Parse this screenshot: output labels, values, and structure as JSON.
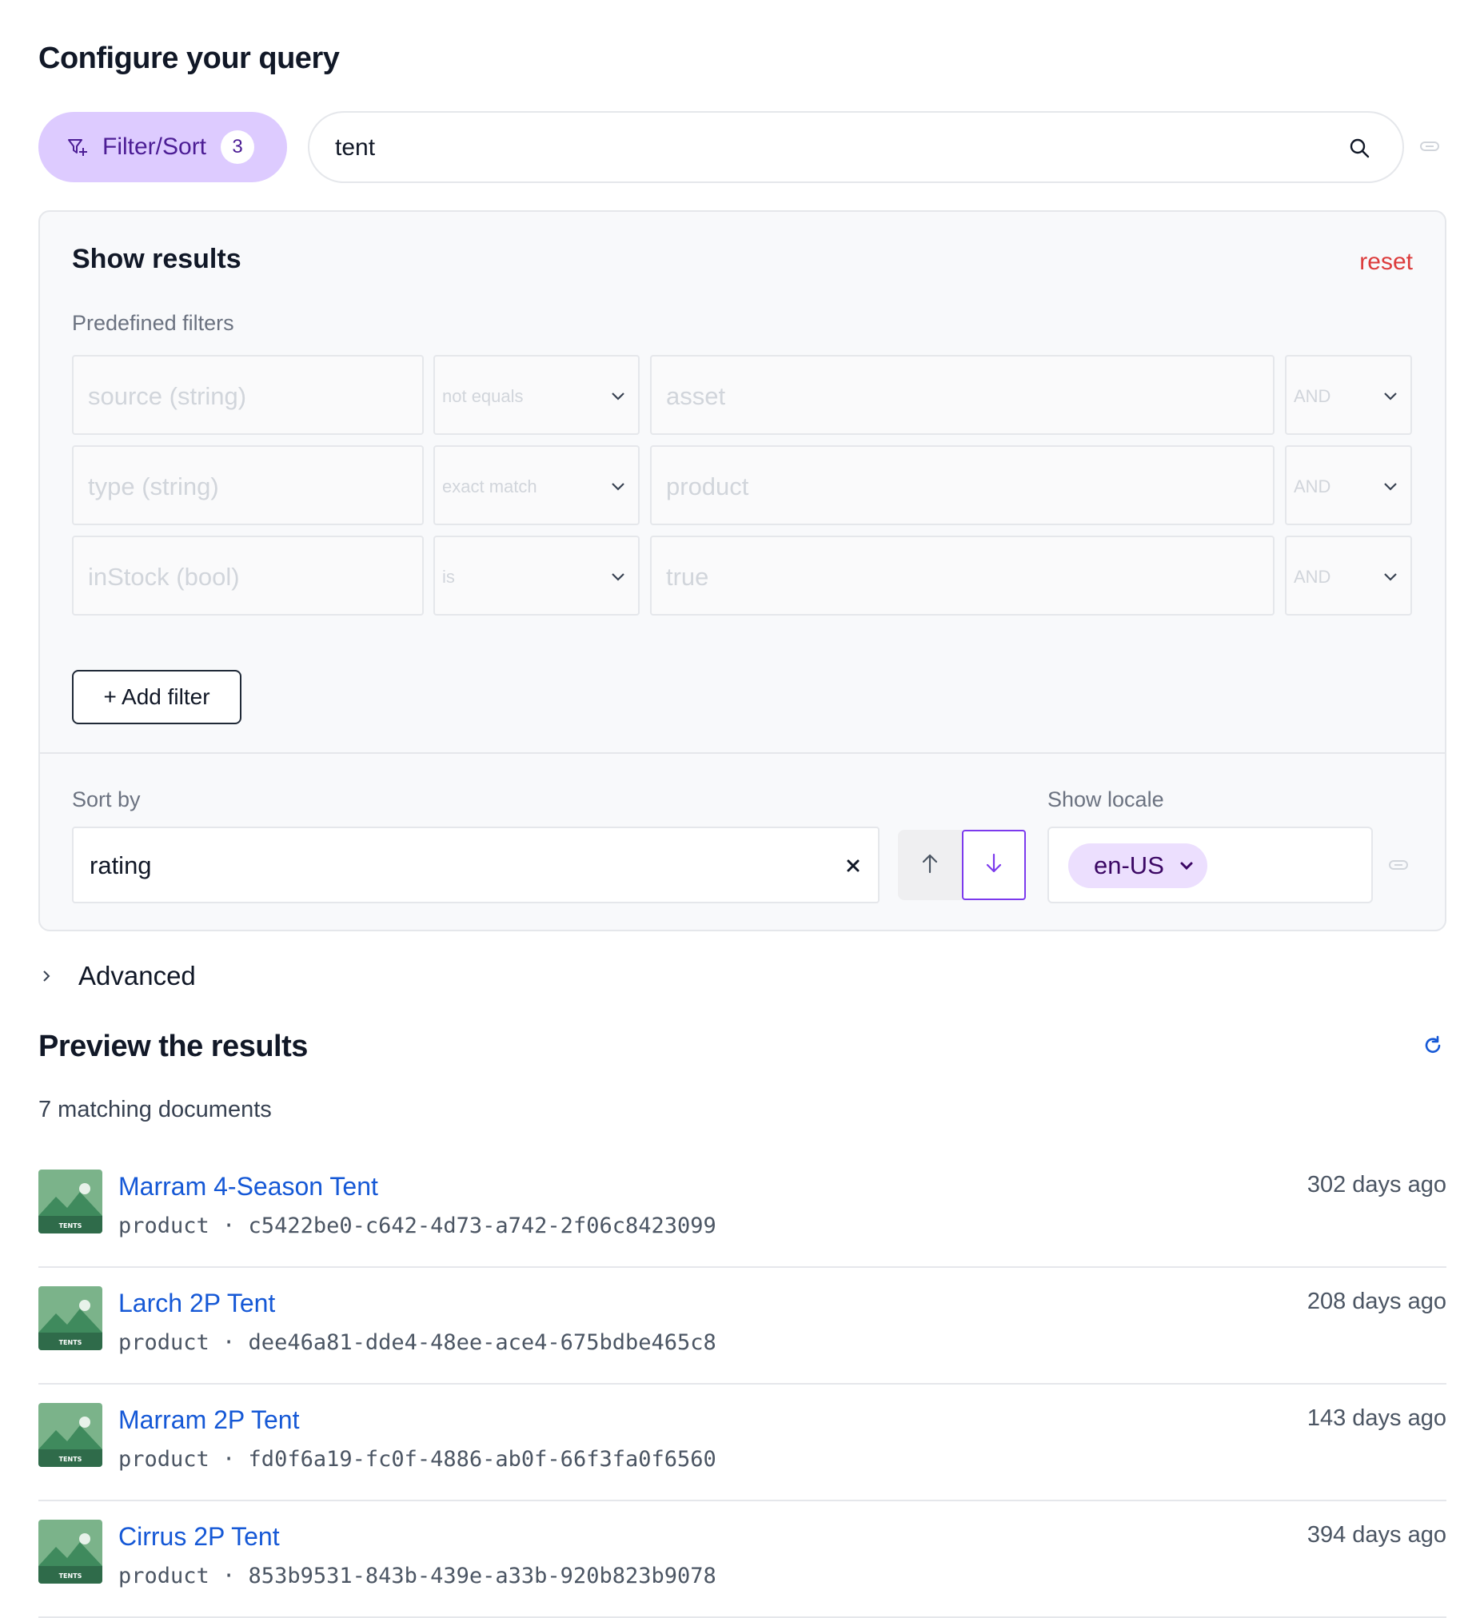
{
  "header": {
    "title": "Configure your query"
  },
  "filter_button": {
    "label": "Filter/Sort",
    "count": "3"
  },
  "search": {
    "value": "tent"
  },
  "panel": {
    "title": "Show results",
    "reset_label": "reset",
    "predefined_label": "Predefined filters",
    "filters": [
      {
        "field": "source (string)",
        "operator": "not equals",
        "value": "asset",
        "conjunction": "AND"
      },
      {
        "field": "type (string)",
        "operator": "exact match",
        "value": "product",
        "conjunction": "AND"
      },
      {
        "field": "inStock (bool)",
        "operator": "is",
        "value": "true",
        "conjunction": "AND"
      }
    ],
    "add_filter_label": "+ Add filter",
    "sort_label": "Sort by",
    "sort_value": "rating",
    "locale_label": "Show locale",
    "locale_value": "en-US"
  },
  "advanced": {
    "label": "Advanced"
  },
  "preview": {
    "title": "Preview the results",
    "count_text": "7 matching documents",
    "thumb_text": "TENTS",
    "results": [
      {
        "title": "Marram 4-Season Tent",
        "meta": "product · c5422be0-c642-4d73-a742-2f06c8423099",
        "time": "302 days ago"
      },
      {
        "title": "Larch 2P Tent",
        "meta": "product · dee46a81-dde4-48ee-ace4-675bdbe465c8",
        "time": "208 days ago"
      },
      {
        "title": "Marram 2P Tent",
        "meta": "product · fd0f6a19-fc0f-4886-ab0f-66f3fa0f6560",
        "time": "143 days ago"
      },
      {
        "title": "Cirrus 2P Tent",
        "meta": "product · 853b9531-843b-439e-a33b-920b823b9078",
        "time": "394 days ago"
      }
    ]
  },
  "colors": {
    "accent_purple": "#7c3aed",
    "filter_pill": "#ddcbff",
    "link_blue": "#1558d6",
    "reset_red": "#dc3b3b"
  }
}
